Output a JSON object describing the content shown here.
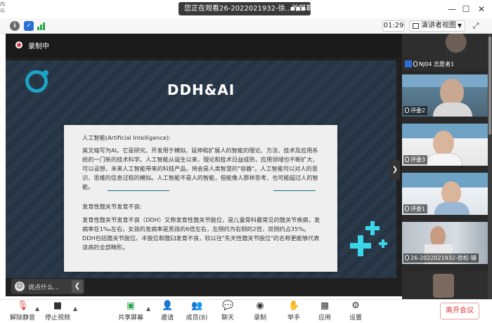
{
  "titlebar": {
    "viewing_text": "您正在观看26-2022021932-徐...的屏幕",
    "left_ghost_lines": [
      "内",
      "以"
    ]
  },
  "toolbar": {
    "time": "01:29",
    "view_mode": "演讲者视图"
  },
  "recording": {
    "label": "录制中"
  },
  "slide": {
    "title": "DDH&AI",
    "section1_heading": "人工智能(Artificial Intelligence):",
    "section1_body": "英文缩写为AI。它是研究、开发用于模拟、延伸和扩展人的智能的理论、方法、技术及应用系统的一门新的技术科学。人工智能从诞生以来，理论和技术日益成熟，应用领域也不断扩大，可以设想，未来人工智能带来的科技产品，将会是人类智慧的\"容器\"。人工智能可以对人的意识、思维的信息过程的模拟。人工智能不是人的智能，但能像人那样思考、也可能超过人的智能。",
    "section2_heading": "发育性髋关节发育不良:",
    "section2_body": "发育性髋关节发育不良（DDH）又称发育性髋关节脱位，是儿童骨科最常见的髋关节疾病，发病率在1‰左右，女孩的发病率是男孩的6倍左右，左侧约为右侧的2倍，双侧约占35%。DDH包括髋关节脱位、半脱位和髋臼发育不良，较以往\"先天性髋关节脱位\"的名称更能够代表该病的全部畸形。"
  },
  "chat": {
    "placeholder": "说点什么..."
  },
  "participants": [
    {
      "name": "NJ04 志愿者1",
      "type": "host"
    },
    {
      "name": "评委2",
      "type": "video"
    },
    {
      "name": "评委3",
      "type": "video"
    },
    {
      "name": "评委1",
      "type": "video"
    },
    {
      "name": "26-2022021932-徐松-辅",
      "type": "video"
    },
    {
      "name": "",
      "type": "video"
    }
  ],
  "bottom_toolbar": {
    "unmute": "解除静音",
    "stop_video": "停止视频",
    "share_screen": "共享屏幕",
    "invite": "邀请",
    "members": "成员(8)",
    "chat": "聊天",
    "record": "录制",
    "raise_hand": "举手",
    "apps": "应用",
    "settings": "设置",
    "leave": "离开会议"
  },
  "colors": {
    "accent_cyan": "#1aa3c4",
    "leave_red": "#d93a3a",
    "recording_red": "#e23a3a"
  }
}
